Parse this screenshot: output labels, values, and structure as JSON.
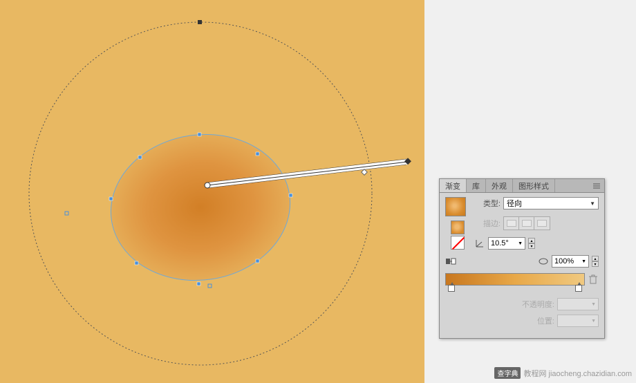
{
  "canvas": {
    "background": "#e8b862"
  },
  "panel": {
    "tabs": {
      "gradient": "渐变",
      "library": "库",
      "appearance": "外观",
      "graphic_styles": "图形样式"
    },
    "type_label": "类型:",
    "type_value": "径向",
    "stroke_label": "描边:",
    "angle_value": "10.5°",
    "aspect_value": "100%",
    "opacity_label": "不透明度:",
    "location_label": "位置:"
  },
  "watermark": {
    "logo": "查字典",
    "url": "教程网 jiaocheng.chazidian.com"
  },
  "chart_data": {
    "type": "gradient-editor",
    "gradient_type": "radial",
    "angle": 10.5,
    "aspect_ratio": 100,
    "stops": [
      {
        "position": 0,
        "color": "#c8771f"
      },
      {
        "position": 100,
        "color": "#f0c980"
      }
    ]
  }
}
